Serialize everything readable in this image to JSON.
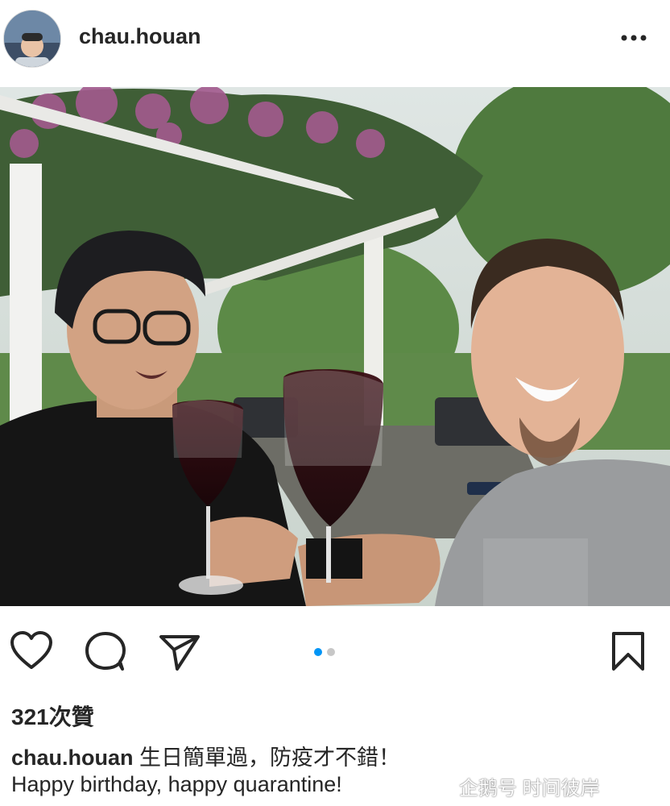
{
  "post": {
    "username": "chau.houan",
    "likes_label": "321次贊",
    "caption_username": "chau.houan",
    "caption_text": "生日簡單過，防疫才不錯！",
    "caption_line2": "Happy birthday, happy quarantine!",
    "carousel": {
      "total": 2,
      "active_index": 0
    }
  },
  "icons": {
    "more": "more-horizontal-icon",
    "like": "heart-icon",
    "comment": "comment-bubble-icon",
    "share": "send-paper-plane-icon",
    "save": "bookmark-icon"
  },
  "colors": {
    "text": "#262626",
    "accent_dot": "#0095f6",
    "inactive_dot": "#c7c7c7"
  },
  "watermark": "企鹅号 时间彼岸"
}
